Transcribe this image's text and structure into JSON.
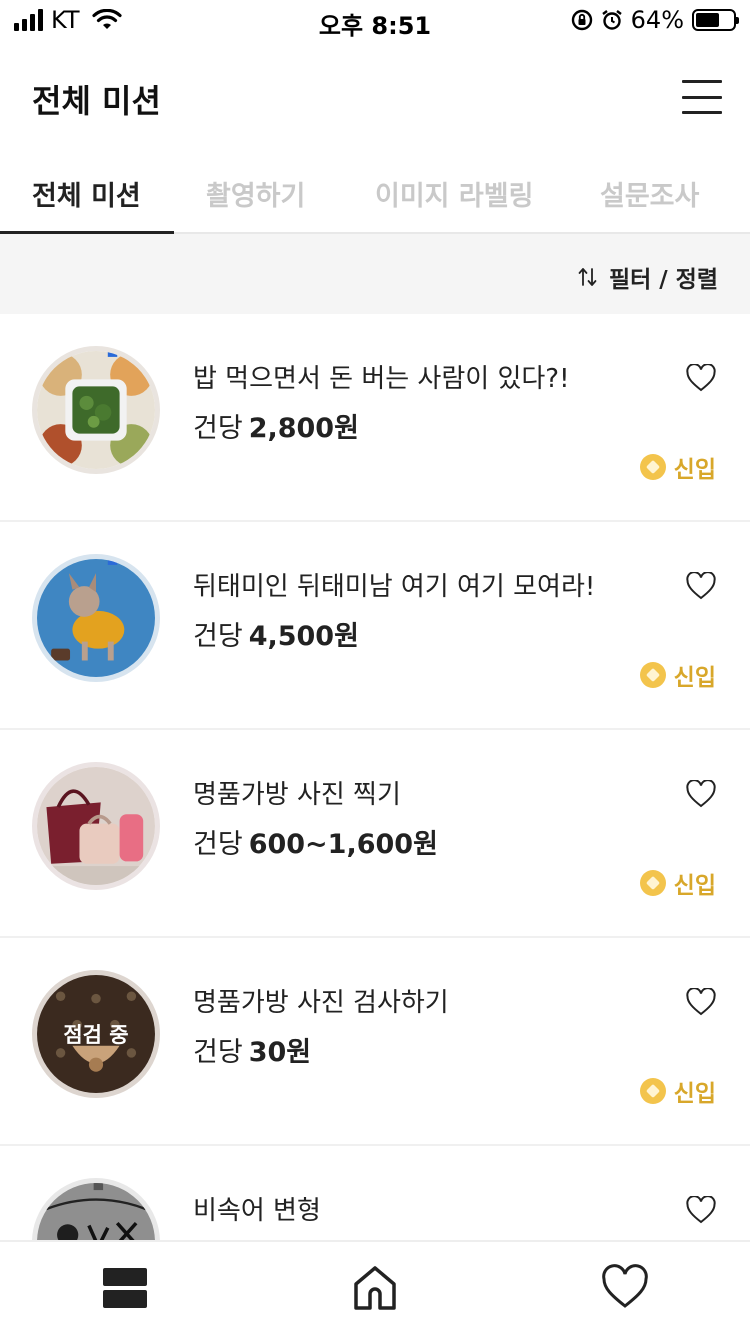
{
  "status_bar": {
    "carrier": "KT",
    "time": "오후 8:51",
    "battery_percent": "64%",
    "battery_level": 0.64
  },
  "header": {
    "title": "전체 미션",
    "menu_icon": "hamburger-menu-icon"
  },
  "tabs": [
    {
      "label": "전체 미션",
      "active": true
    },
    {
      "label": "촬영하기",
      "active": false
    },
    {
      "label": "이미지 라벨링",
      "active": false
    },
    {
      "label": "설문조사",
      "active": false
    }
  ],
  "filter": {
    "label": "필터 / 정렬",
    "icon": "sort-arrows-icon"
  },
  "missions": [
    {
      "title": "밥 먹으면서 돈 버는 사람이 있다?!",
      "price_prefix": "건당",
      "price": "2,800원",
      "badge": "신입",
      "thumb_overlay": "",
      "thumb_icon": "food-tray-image"
    },
    {
      "title": "뒤태미인 뒤태미남 여기 여기 모여라!",
      "price_prefix": "건당",
      "price": "4,500원",
      "badge": "신입",
      "thumb_overlay": "",
      "thumb_icon": "dog-photo-image"
    },
    {
      "title": "명품가방 사진 찍기",
      "price_prefix": "건당",
      "price": "600~1,600원",
      "badge": "신입",
      "thumb_overlay": "",
      "thumb_icon": "handbag-photo-image"
    },
    {
      "title": "명품가방 사진 검사하기",
      "price_prefix": "건당",
      "price": "30원",
      "badge": "신입",
      "thumb_overlay": "점검 중",
      "thumb_icon": "monogram-bag-image"
    },
    {
      "title": "비속어 변형",
      "price_prefix": "",
      "price": "",
      "badge": "",
      "thumb_overlay": "",
      "thumb_icon": "doodle-image"
    }
  ],
  "bottom_nav": [
    {
      "name": "list-icon"
    },
    {
      "name": "home-icon"
    },
    {
      "name": "heart-icon"
    }
  ],
  "colors": {
    "accent_gold": "#d8a72a",
    "badge_gold": "#f3c44c",
    "text_dark": "#222222",
    "tab_inactive": "#c9c9c9",
    "filter_bg": "#f5f5f5"
  }
}
